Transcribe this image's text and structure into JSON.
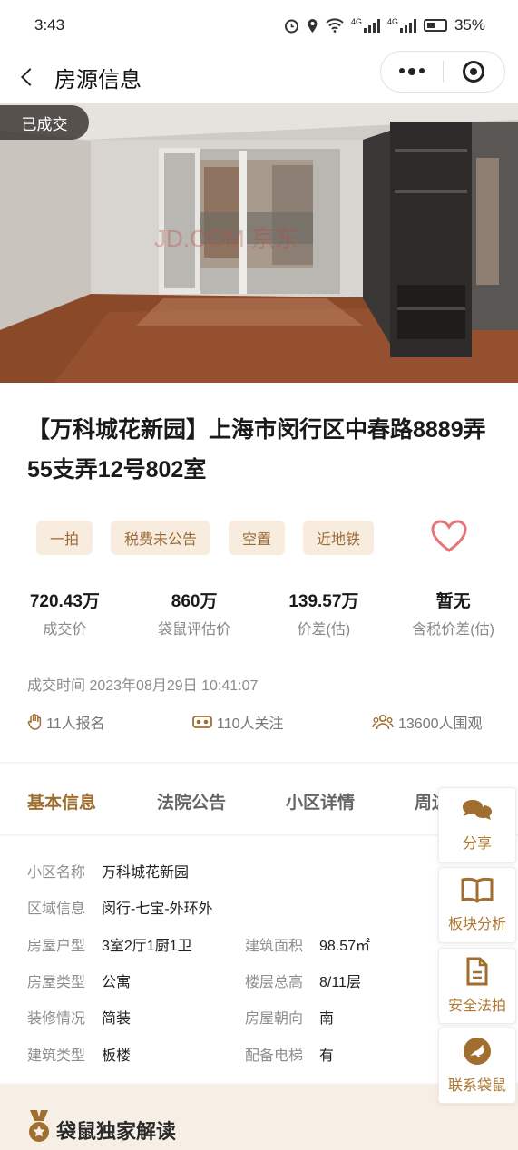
{
  "status_bar": {
    "time": "3:43",
    "network1": "4G",
    "network2": "4G",
    "battery": "35%"
  },
  "nav": {
    "title": "房源信息"
  },
  "photo": {
    "badge": "已成交",
    "watermark": "JD.COM 京东"
  },
  "listing": {
    "title": "【万科城花新园】上海市闵行区中春路8889弄55支弄12号802室",
    "tags": [
      "一拍",
      "税费未公告",
      "空置",
      "近地铁"
    ],
    "stats": [
      {
        "value": "720.43万",
        "label": "成交价"
      },
      {
        "value": "860万",
        "label": "袋鼠评估价"
      },
      {
        "value": "139.57万",
        "label": "价差(估)"
      },
      {
        "value": "暂无",
        "label": "含税价差(估)"
      }
    ],
    "deal_time": "成交时间 2023年08月29日 10:41:07",
    "metrics": {
      "signups": "11人报名",
      "followers": "110人关注",
      "viewers": "13600人围观"
    }
  },
  "tabs": [
    "基本信息",
    "法院公告",
    "小区详情",
    "周边"
  ],
  "basic_info": {
    "community": {
      "label": "小区名称",
      "value": "万科城花新园"
    },
    "district": {
      "label": "区域信息",
      "value": "闵行-七宝-外环外"
    },
    "layout": {
      "label": "房屋户型",
      "value": "3室2厅1厨1卫"
    },
    "area": {
      "label": "建筑面积",
      "value": "98.57㎡"
    },
    "type": {
      "label": "房屋类型",
      "value": "公寓"
    },
    "floor": {
      "label": "楼层总高",
      "value": "8/11层"
    },
    "decoration": {
      "label": "装修情况",
      "value": "简装"
    },
    "orientation": {
      "label": "房屋朝向",
      "value": "南"
    },
    "building": {
      "label": "建筑类型",
      "value": "板楼"
    },
    "elevator": {
      "label": "配备电梯",
      "value": "有"
    }
  },
  "reading": {
    "title": "袋鼠独家解读"
  },
  "side_buttons": [
    {
      "label": "分享",
      "icon": "chat-bubbles-icon"
    },
    {
      "label": "板块分析",
      "icon": "book-icon"
    },
    {
      "label": "安全法拍",
      "icon": "document-icon"
    },
    {
      "label": "联系袋鼠",
      "icon": "kangaroo-icon"
    }
  ],
  "colors": {
    "accent": "#a06e2f",
    "tag_bg": "#f8ecdf",
    "heart": "#e8727a"
  }
}
